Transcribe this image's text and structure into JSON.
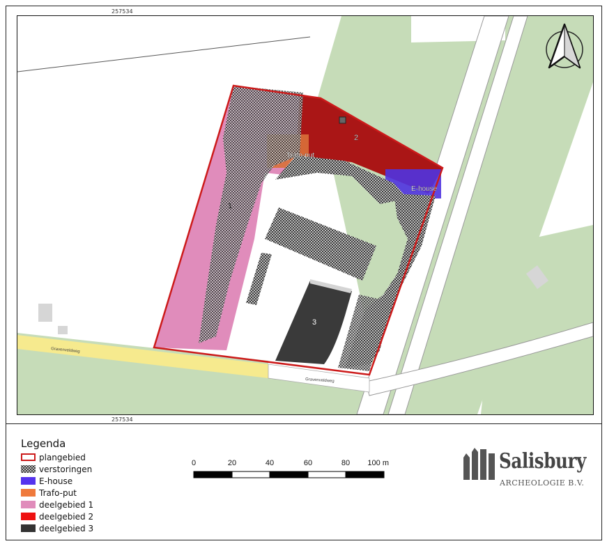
{
  "map": {
    "coord_top": "257534",
    "coord_bottom": "257534",
    "street_label_1": "Gravenveldweg",
    "street_label_2": "Gravenveldweg",
    "area_labels": {
      "area_1": "1",
      "area_2": "2",
      "area_3": "3",
      "trafo": "Trafo-put",
      "ehouse": "E-house"
    }
  },
  "legend": {
    "title": "Legenda",
    "items": [
      {
        "label": "plangebied",
        "color": "#cc1a1a"
      },
      {
        "label": "verstoringen",
        "color": "#333333"
      },
      {
        "label": "E-house",
        "color": "#5533ee"
      },
      {
        "label": "Trafo-put",
        "color": "#ef7a3c"
      },
      {
        "label": "deelgebied 1",
        "color": "#e08cbb"
      },
      {
        "label": "deelgebied 2",
        "color": "#ee1111"
      },
      {
        "label": "deelgebied 3",
        "color": "#333333"
      }
    ]
  },
  "scalebar": {
    "ticks": [
      "0",
      "20",
      "40",
      "60",
      "80",
      "100 m"
    ]
  },
  "logo": {
    "name": "Salisbury",
    "subtitle": "ARCHEOLOGIE B.V."
  },
  "icons": {
    "north_arrow": "north-arrow-icon",
    "logo_mark": "salisbury-columns-icon"
  }
}
